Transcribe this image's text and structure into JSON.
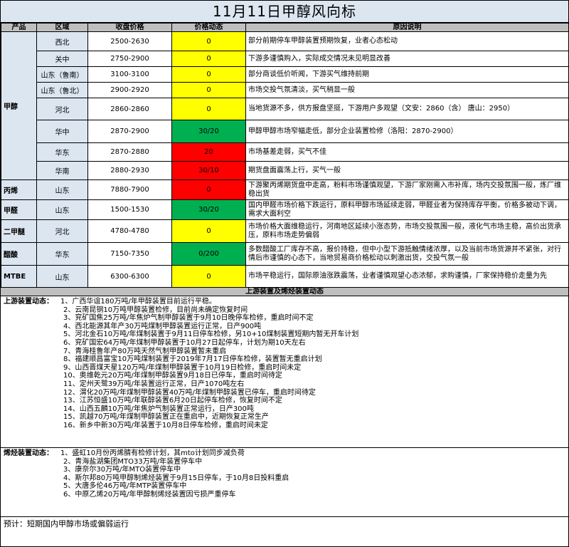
{
  "title": "11月11日甲醇风向标",
  "headers": {
    "product": "产品",
    "region": "区域",
    "price": "收盘价格",
    "change": "价格动态",
    "reason": "原因说明"
  },
  "rows": [
    {
      "product": "甲醇",
      "span": 8,
      "region": "西北",
      "price": "2500-2630",
      "change": "0",
      "color": "yellow",
      "reason": "部分前期停车甲醇装置预期恢复，业者心态松动"
    },
    {
      "region": "关中",
      "price": "2750-2900",
      "change": "0",
      "color": "yellow",
      "reason": "下游多谨慎购入，实际成交情况未见明显改善"
    },
    {
      "region": "山东（鲁南）",
      "price": "3100-3100",
      "change": "0",
      "color": "yellow",
      "reason": "部分商谈低价听闻，下游买气维持前期"
    },
    {
      "region": "山东（鲁北）",
      "price": "2900-2920",
      "change": "0",
      "color": "yellow",
      "reason": "市场交投气氛清淡，买气稍显一般"
    },
    {
      "region": "河北",
      "price": "2860-2860",
      "change": "0",
      "color": "yellow",
      "reason": "当地货源不多，供方报盘坚挺，下游用户多观望（文安：2860（含）  唐山：2950）"
    },
    {
      "region": "华中",
      "price": "2870-2900",
      "change": "30/20",
      "color": "green",
      "reason": "甲醇甲醇市场窄幅走低，部分企业装置检修（洛阳：2870-2900）"
    },
    {
      "region": "华东",
      "price": "2870-2880",
      "change": "20",
      "color": "red",
      "reason": "市场基差走弱，买气不佳"
    },
    {
      "region": "华南",
      "price": "2880-2930",
      "change": "30/10",
      "color": "red",
      "reason": "期货盘面震荡上行，买气一般"
    },
    {
      "product": "丙烯",
      "span": 1,
      "region": "山东",
      "price": "7880-7900",
      "change": "0",
      "color": "red",
      "reason": "下游聚丙烯期货盘中走高，粉料市场谨慎观望，下游厂家刚需入市补库，场内交投氛围一般，炼厂维稳出货"
    },
    {
      "product": "甲醛",
      "span": 1,
      "region": "山东",
      "price": "1500-1530",
      "change": "30/20",
      "color": "green",
      "reason": "国内甲醛市场价格下跌运行，原料甲醇市场延续走弱，甲醛业者为保持库存平衡，价格多被动下调，需求大面利空"
    },
    {
      "product": "二甲醚",
      "span": 1,
      "region": "河北",
      "price": "4780-4780",
      "change": "0",
      "color": "yellow",
      "reason": "市场价格大面维稳运行，河南地区延续小涨态势，市场交投氛围一般，液化气市场主稳，高价出货承压，原料市场走势偏弱"
    },
    {
      "product": "醋酸",
      "span": 1,
      "region": "华东",
      "price": "7150-7350",
      "change": "0/200",
      "color": "green",
      "reason": "多数醋酸工厂库存不高，报价持稳，但中小型下游抵触情绪浓厚，以及当前市场货源并不紧张，对行情后市谨慎的心态下，当地贸易商价格松动以刺激出货，交投气氛一般"
    },
    {
      "product": "MTBE",
      "span": 1,
      "region": "山东",
      "price": "6300-6300",
      "change": "0",
      "color": "yellow",
      "reason": "市场平稳运行，国际原油涨跌震荡，业者谨慎观望心态浓郁，求购谨慎，厂家保持稳价走量为先"
    }
  ],
  "section_title": "上游装置及烯烃装置动态",
  "upstream": {
    "lead": "上游装置动态：",
    "items": [
      "1、广西华谊180万吨/年甲醇装置目前运行平稳。",
      "2、云南昆钢10万吨甲醇装置检修，目前尚未确定恢复时间",
      "3、兖矿国焦25万吨/年焦炉气制甲醇装置于9月10日晚停车检修，重启时间不定",
      "4、西北能源其年产30万吨煤制甲醇装置运行正常，日产900吨",
      "5、河北金石10万吨/年煤制装置于9月11日停车检修，另10+10煤制装置短期内暂无开车计划",
      "6、兖矿国宏64万吨/年煤制甲醇装置于10月27日起停车，计划为期10天左右",
      "7、青海桂鲁年产80万吨天然气制甲醇装置暂未重启",
      "8、福建顺昌富宝10万吨煤制装置于2019年7月17日停车检修，装置暂无重启计划",
      "9、山西晋煤天星120万吨/年煤制甲醇装置于10月19日检修，重启时间未定",
      "10、奥维乾元20万吨/年煤制甲醇装置9月18日已停车，重启时间待定",
      "11、定州天鹭39万吨/年装置运行正常，日产1070吨左右",
      "12、渭化20万吨/年煤制甲醇装置40万吨/年煤制甲醇装置已停车，重启时间待定",
      "13、江苏恒盛10万吨/年联醇装置6月20日起停车检修，恢复时间不定",
      "14、山西五麟10万吨/年焦炉气制装置正常运行，日产300吨",
      "15、凯越70万吨/年煤制甲醇装置正在重启中，近期恢复正常生产",
      "16、新乡中新30万吨/年装置于10月8日停车检修，重启时间未定"
    ]
  },
  "olefin": {
    "lead": "烯烃装置动态：",
    "items": [
      "1、盛虹10月份丙烯腈有检修计划，其mto计划同步减负荷",
      "2、青海盐湖集团MTO33万吨/年装置停车中",
      "3、康奈尔30万吨/年MTO装置停车中",
      "4、斯尔邦80万吨甲醇制烯烃装置于9月15日停车，于10月8日投料重启",
      "5、大唐多伦46万吨/年MTP装置停车中",
      "6、中原乙烯20万吨/年甲醇制烯烃装置因亏损严重停车"
    ]
  },
  "forecast": "预计：短期国内甲醇市场或偏弱运行"
}
